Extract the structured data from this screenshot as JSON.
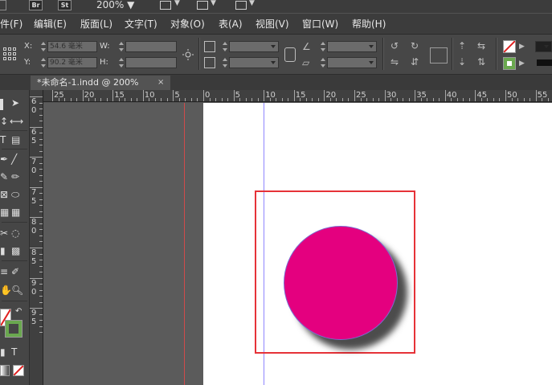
{
  "appbar": {
    "badges": [
      "Br",
      "St"
    ],
    "zoom": "200%"
  },
  "menu": {
    "items": [
      "件(F)",
      "编辑(E)",
      "版面(L)",
      "文字(T)",
      "对象(O)",
      "表(A)",
      "视图(V)",
      "窗口(W)",
      "帮助(H)"
    ]
  },
  "control": {
    "x_label": "X:",
    "x_value": "54.6 毫米",
    "y_label": "Y:",
    "y_value": "90.2 毫米",
    "w_label": "W:",
    "h_label": "H:"
  },
  "document": {
    "tab_title": "*未命名-1.indd @ 200%",
    "close_glyph": "×"
  },
  "ruler": {
    "horizontal": [
      "25",
      "20",
      "15",
      "10",
      "5",
      "0",
      "5",
      "10",
      "15",
      "20",
      "25",
      "30",
      "35",
      "40",
      "45",
      "50",
      "55"
    ],
    "vertical": [
      "6",
      "6",
      "7",
      "7",
      "8",
      "8",
      "9",
      "9"
    ]
  },
  "tools": {
    "type_glyph": "T"
  },
  "colors": {
    "circle_fill": "#e4007f",
    "frame_stroke": "#e63238",
    "bleed_guide": "#d04b4b",
    "margin_guide": "#8f86ff",
    "stroke_swatch": "#6aa84f"
  }
}
